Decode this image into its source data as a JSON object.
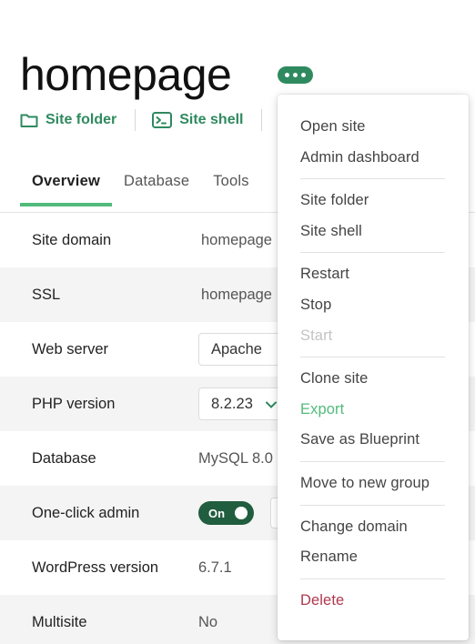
{
  "site": {
    "title": "homepage"
  },
  "quick_links": [
    {
      "label": "Site folder",
      "icon": "folder-icon"
    },
    {
      "label": "Site shell",
      "icon": "terminal-icon"
    }
  ],
  "tabs": [
    {
      "label": "Overview",
      "active": true
    },
    {
      "label": "Database",
      "active": false
    },
    {
      "label": "Tools",
      "active": false
    }
  ],
  "overview": {
    "site_domain": {
      "label": "Site domain",
      "value": "homepage"
    },
    "ssl": {
      "label": "SSL",
      "value": "homepage"
    },
    "web_server": {
      "label": "Web server",
      "value": "Apache"
    },
    "php_version": {
      "label": "PHP version",
      "value": "8.2.23"
    },
    "database": {
      "label": "Database",
      "value": "MySQL 8.0"
    },
    "one_click_admin": {
      "label": "One-click admin",
      "toggle": "On"
    },
    "wordpress_version": {
      "label": "WordPress version",
      "value": "6.7.1"
    },
    "multisite": {
      "label": "Multisite",
      "value": "No"
    }
  },
  "menu": {
    "open_site": "Open site",
    "admin_dashboard": "Admin dashboard",
    "site_folder": "Site folder",
    "site_shell": "Site shell",
    "restart": "Restart",
    "stop": "Stop",
    "start": "Start",
    "clone_site": "Clone site",
    "export": "Export",
    "save_as_blueprint": "Save as Blueprint",
    "move_to_new_group": "Move to new group",
    "change_domain": "Change domain",
    "rename": "Rename",
    "delete": "Delete"
  },
  "colors": {
    "brand_green": "#2f8a5f",
    "tab_accent": "#51bb7b",
    "toggle_on": "#215d3f",
    "danger": "#b0384f"
  }
}
